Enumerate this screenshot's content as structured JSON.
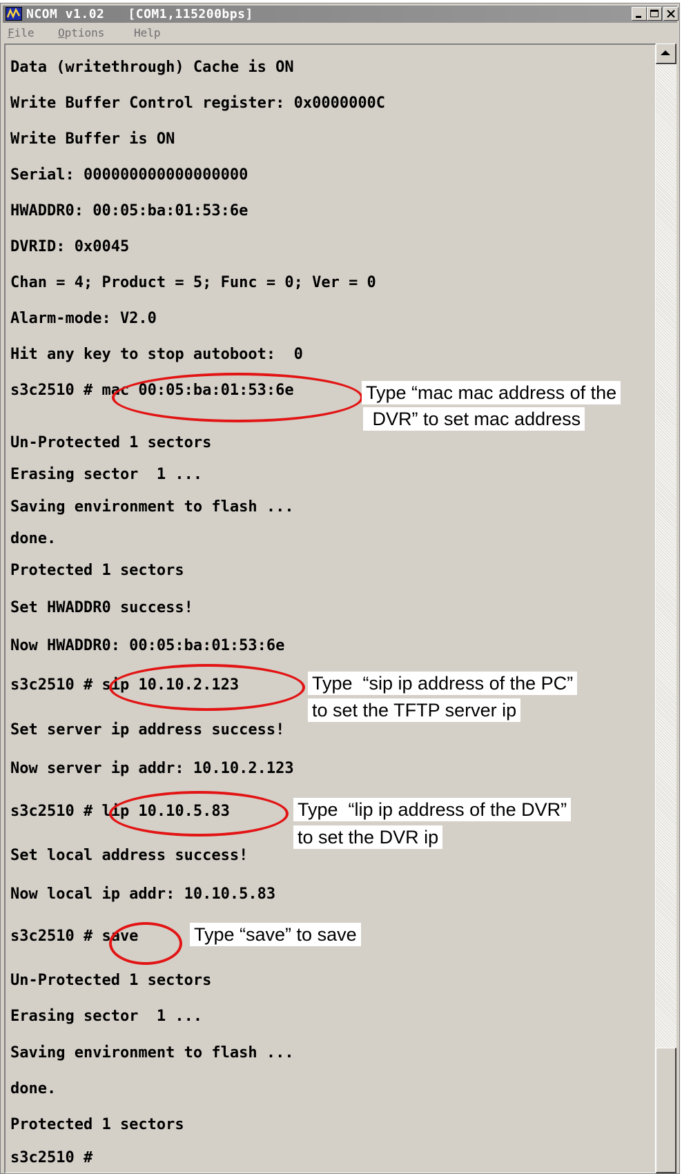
{
  "window": {
    "app_name": "NCOM v1.02",
    "port_info": "[COM1,115200bps]",
    "controls": [
      "minimize",
      "maximize",
      "close"
    ]
  },
  "menu": {
    "file": {
      "first": "F",
      "rest": "ile"
    },
    "options": {
      "first": "O",
      "rest": "ptions"
    },
    "help": {
      "first": "",
      "rest": "Help"
    }
  },
  "terminal_lines": [
    "Data (writethrough) Cache is ON",
    "Write Buffer Control register: 0x0000000C",
    "Write Buffer is ON",
    "Serial: 000000000000000000",
    "HWADDR0: 00:05:ba:01:53:6e",
    "DVRID: 0x0045",
    "Chan = 4; Product = 5; Func = 0; Ver = 0",
    "Alarm-mode: V2.0",
    "Hit any key to stop autoboot:  0",
    "s3c2510 # mac 00:05:ba:01:53:6e",
    "Un-Protected 1 sectors",
    "Erasing sector  1 ...",
    "Saving environment to flash ...",
    "done.",
    "Protected 1 sectors",
    "Set HWADDR0 success!",
    "Now HWADDR0: 00:05:ba:01:53:6e",
    "s3c2510 # sip 10.10.2.123",
    "Set server ip address success!",
    "Now server ip addr: 10.10.2.123",
    "s3c2510 # lip 10.10.5.83",
    "Set local address success!",
    "Now local ip addr: 10.10.5.83",
    "s3c2510 # save",
    "Un-Protected 1 sectors",
    "Erasing sector  1 ...",
    "Saving environment to flash ...",
    "done.",
    "Protected 1 sectors",
    "s3c2510 #"
  ],
  "annotations": {
    "mac_line1": "Type “mac mac address of the",
    "mac_line2": " DVR” to set mac address",
    "sip_line1": "Type  “sip ip address of the PC”",
    "sip_line2": "to set the TFTP server ip",
    "lip_line1": "Type  “lip ip address of the DVR”",
    "lip_line2": "to set the DVR ip",
    "save_line1": "Type “save” to save"
  },
  "colors": {
    "annotation_circle": "#e21414",
    "title_bar": "#808080",
    "window_face": "#d4d0c8"
  }
}
